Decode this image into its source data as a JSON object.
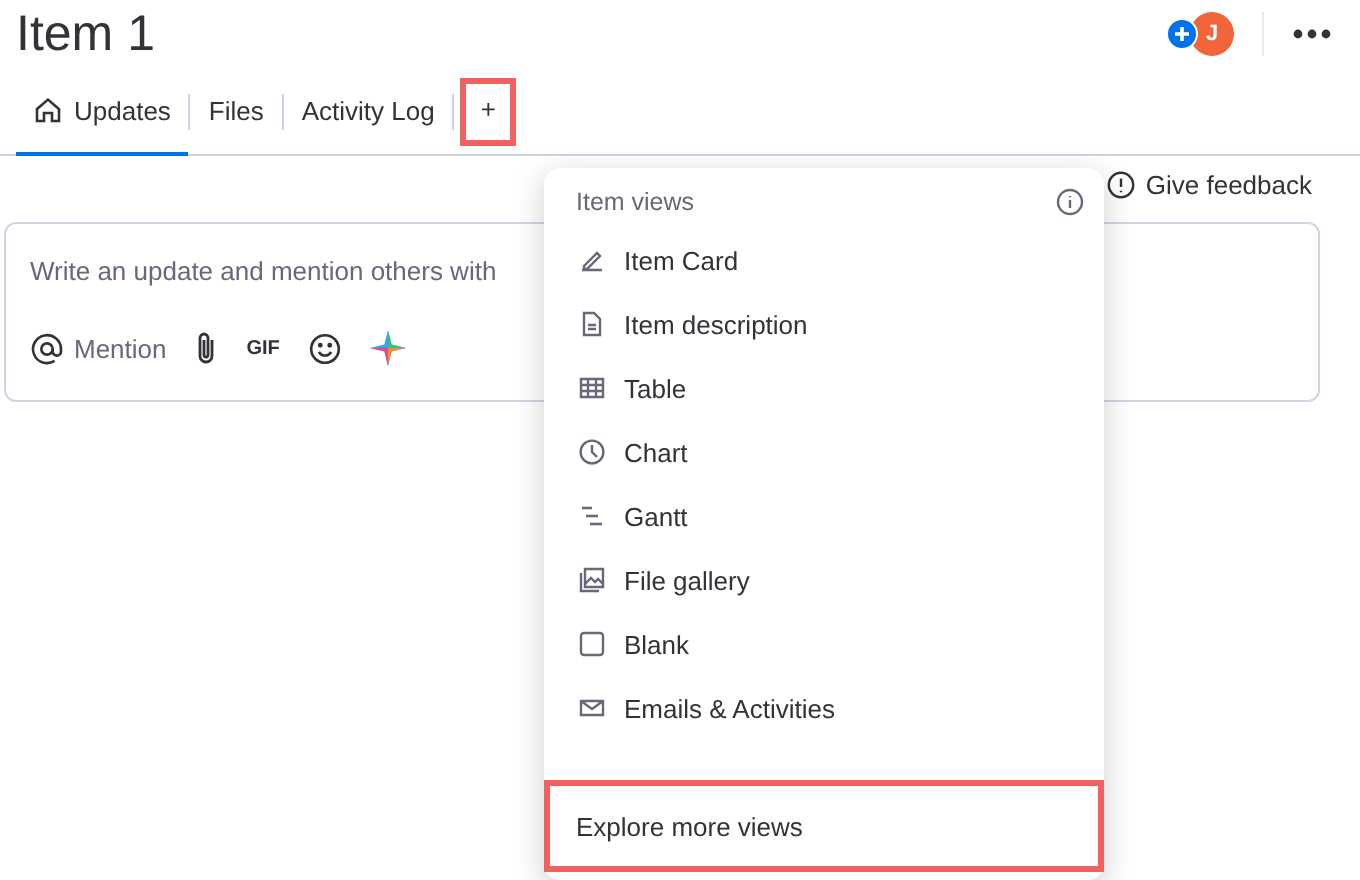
{
  "title": "Item 1",
  "avatar": {
    "initial": "J"
  },
  "tabs": [
    {
      "label": "Updates",
      "selected": true,
      "kind": "home",
      "highlighted": false
    },
    {
      "label": "Files",
      "selected": false,
      "kind": "plain",
      "highlighted": false
    },
    {
      "label": "Activity Log",
      "selected": false,
      "kind": "plain",
      "highlighted": false
    },
    {
      "label": "+",
      "selected": false,
      "kind": "add",
      "highlighted": true
    }
  ],
  "feedback": {
    "label": "Give feedback"
  },
  "composer": {
    "placeholder": "Write an update and mention others with",
    "mention": "Mention",
    "gif": "GIF"
  },
  "menu": {
    "heading": "Item views",
    "items": [
      {
        "label": "Item Card",
        "kind": "card"
      },
      {
        "label": "Item description",
        "kind": "doc"
      },
      {
        "label": "Table",
        "kind": "table"
      },
      {
        "label": "Chart",
        "kind": "chart"
      },
      {
        "label": "Gantt",
        "kind": "gantt"
      },
      {
        "label": "File gallery",
        "kind": "gallery"
      },
      {
        "label": "Blank",
        "kind": "blank"
      },
      {
        "label": "Emails & Activities",
        "kind": "mail"
      }
    ],
    "footer": {
      "label": "Explore more views",
      "highlighted": true
    }
  }
}
